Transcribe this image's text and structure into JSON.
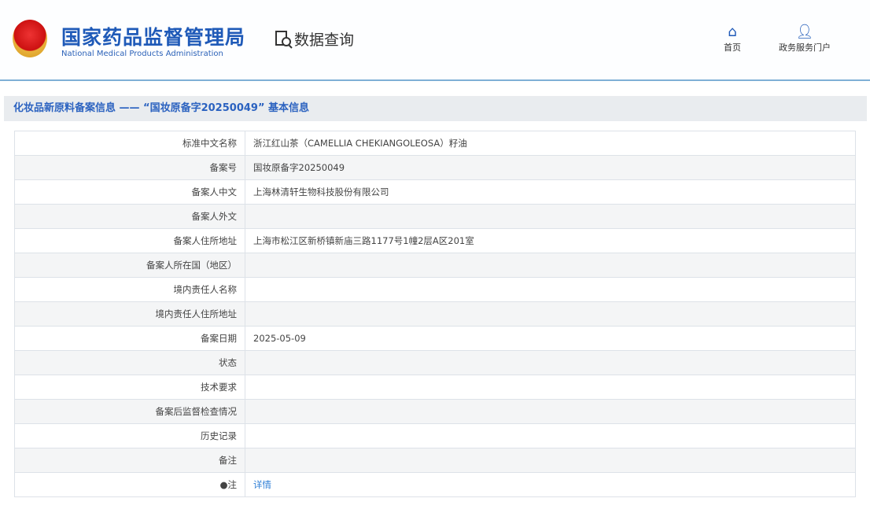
{
  "header": {
    "org_cn": "国家药品监督管理局",
    "org_en": "National Medical Products Administration",
    "data_query": "数据查询",
    "nav": [
      {
        "label": "首页",
        "icon": "home-icon"
      },
      {
        "label": "政务服务门户",
        "icon": "user-icon"
      }
    ]
  },
  "title": "化妆品新原料备案信息 —— “国妆原备字20250049” 基本信息",
  "rows": [
    {
      "label": "标准中文名称",
      "value": "浙江红山茶（CAMELLIA CHEKIANGOLEOSA）籽油"
    },
    {
      "label": "备案号",
      "value": "国妆原备字20250049"
    },
    {
      "label": "备案人中文",
      "value": "上海林清轩生物科技股份有限公司"
    },
    {
      "label": "备案人外文",
      "value": ""
    },
    {
      "label": "备案人住所地址",
      "value": "上海市松江区新桥镇新庙三路1177号1幢2层A区201室"
    },
    {
      "label": "备案人所在国（地区）",
      "value": ""
    },
    {
      "label": "境内责任人名称",
      "value": ""
    },
    {
      "label": "境内责任人住所地址",
      "value": ""
    },
    {
      "label": "备案日期",
      "value": "2025-05-09"
    },
    {
      "label": "状态",
      "value": ""
    },
    {
      "label": "技术要求",
      "value": ""
    },
    {
      "label": "备案后监督检查情况",
      "value": ""
    },
    {
      "label": "历史记录",
      "value": ""
    },
    {
      "label": "备注",
      "value": ""
    },
    {
      "label": "●注",
      "value": "详情"
    }
  ]
}
